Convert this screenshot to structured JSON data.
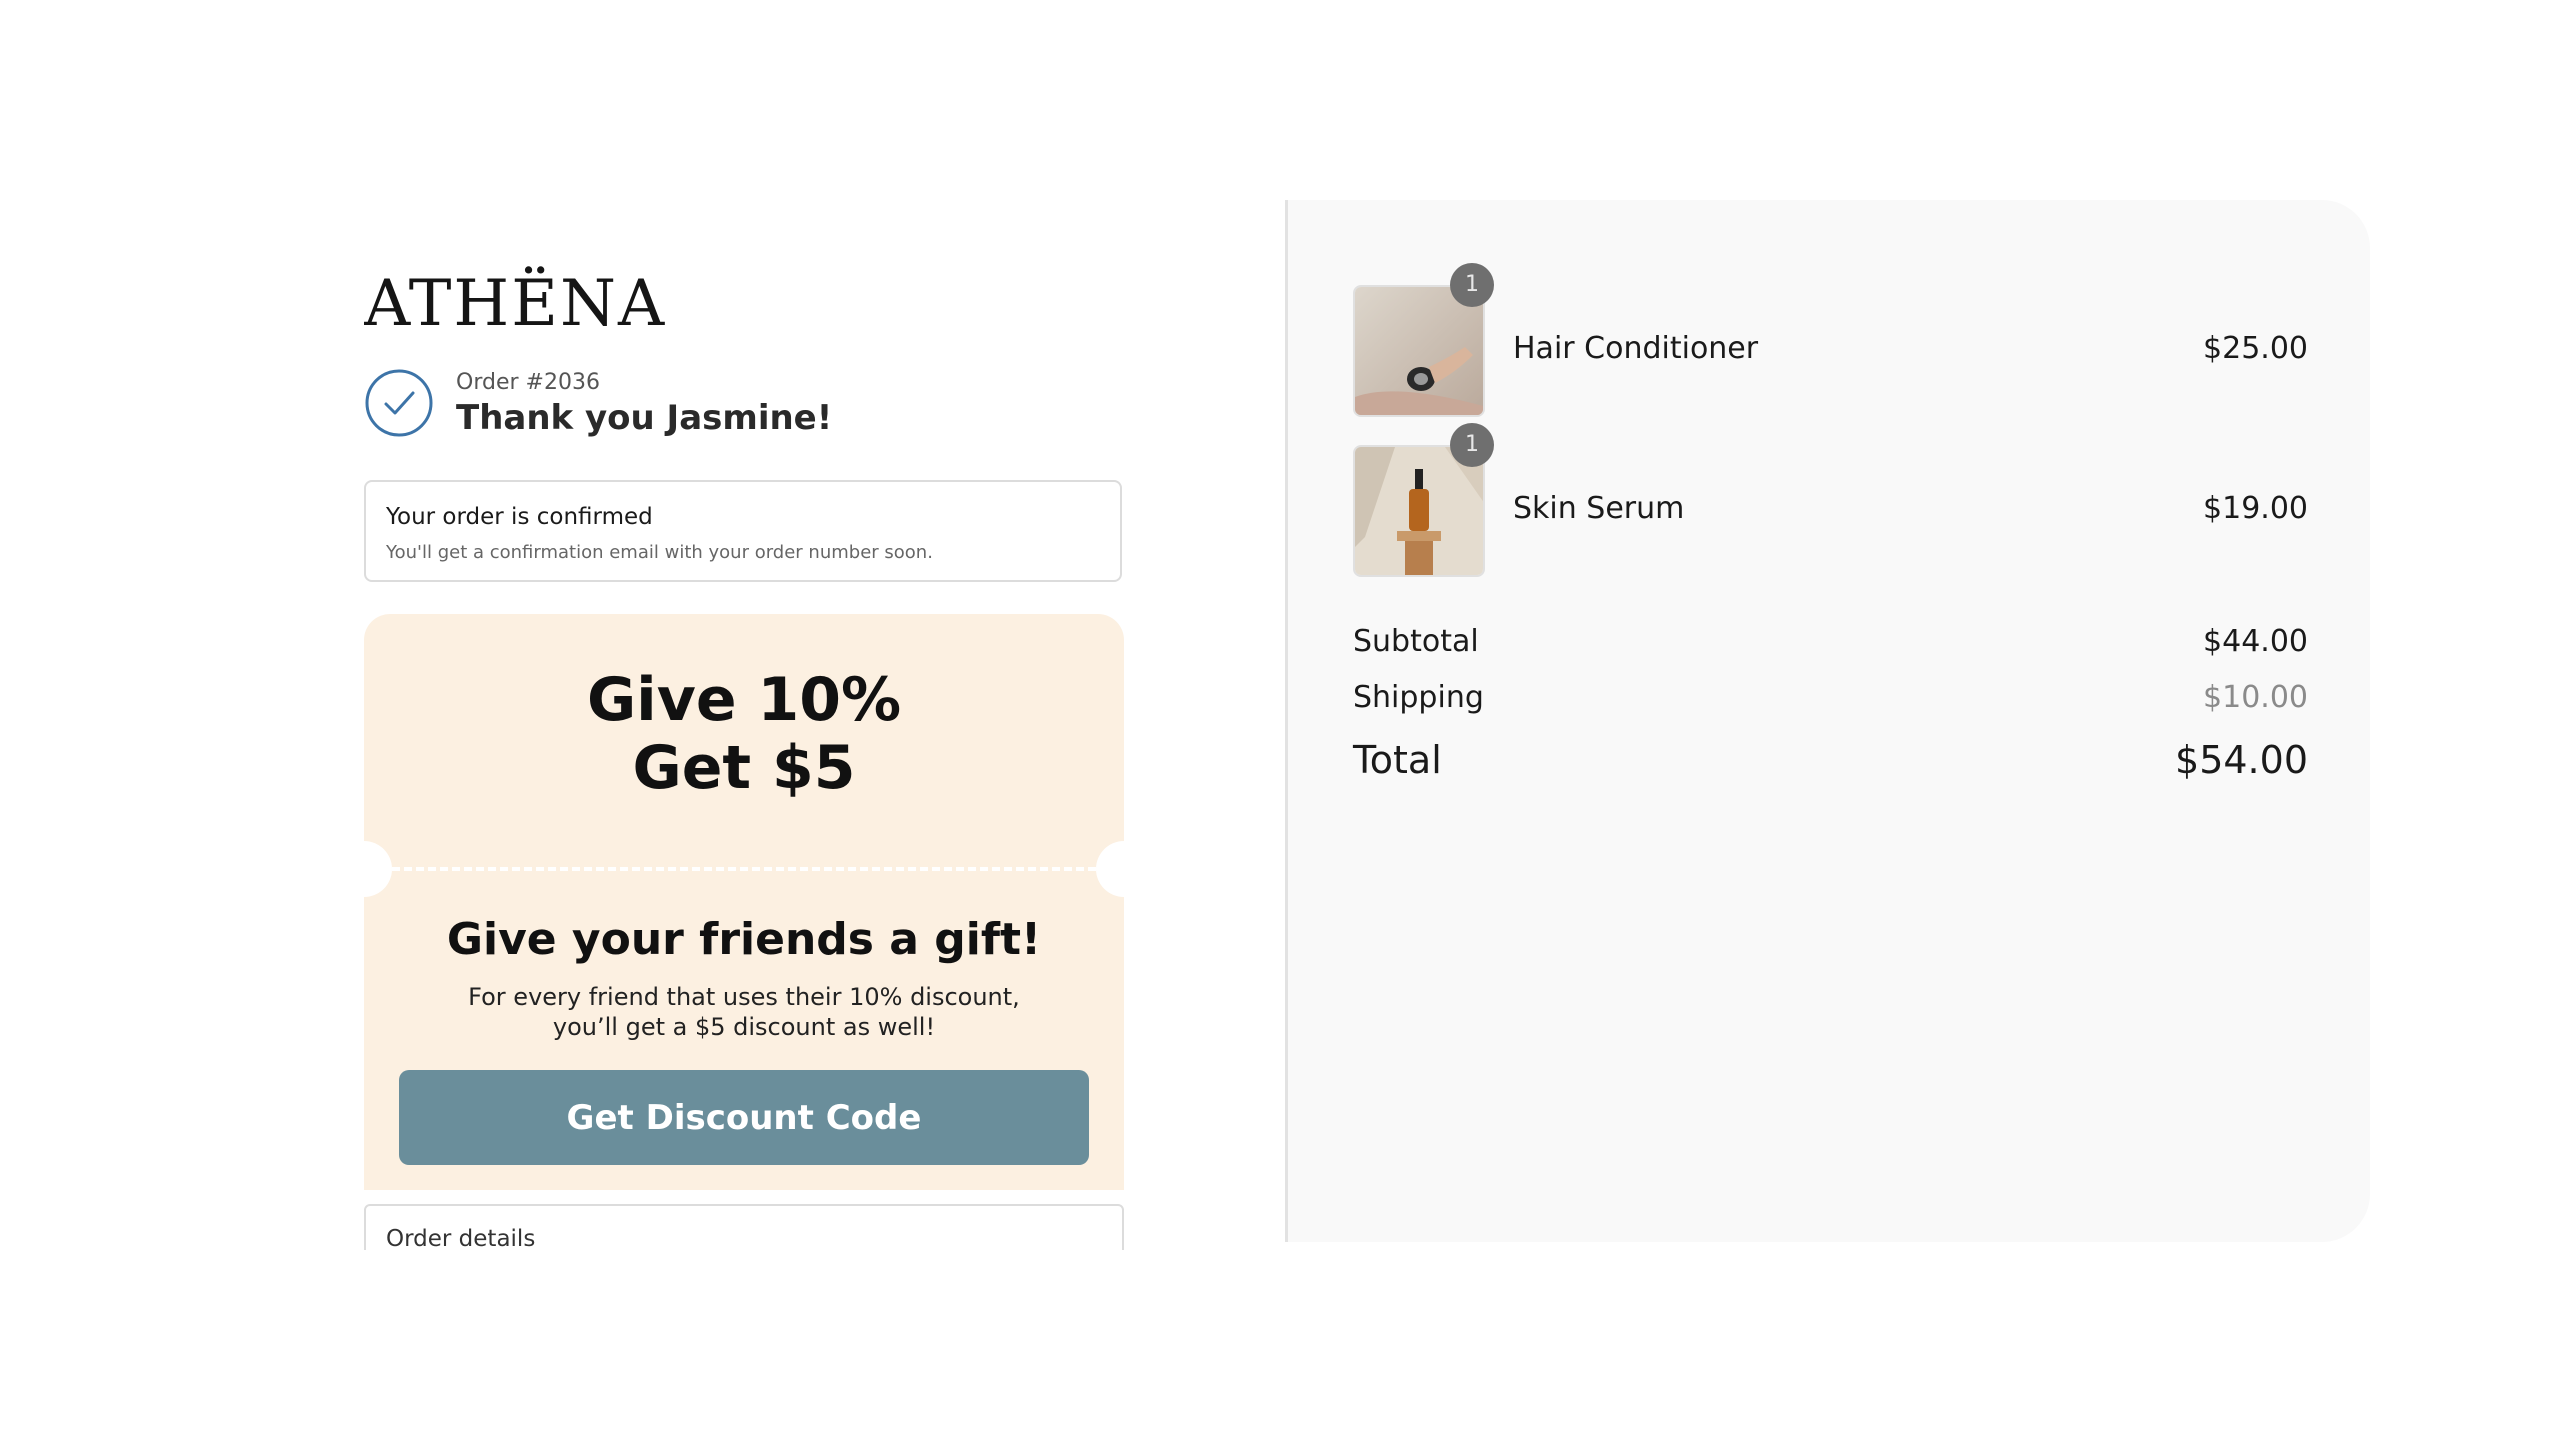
{
  "brand": {
    "logo_text": "ATHËNA"
  },
  "order": {
    "number": "Order #2036",
    "thank_you": "Thank you Jasmine!"
  },
  "confirmation": {
    "title": "Your order is confirmed",
    "text": "You'll get a confirmation email with your order number soon."
  },
  "promo": {
    "headline_line1": "Give 10%",
    "headline_line2": "Get $5",
    "gift_title": "Give your friends a gift!",
    "gift_text_line1": "For every friend that uses their 10% discount,",
    "gift_text_line2": "you’ll get a $5 discount as well!",
    "button_label": "Get Discount Code",
    "button_color": "#6a8e9b",
    "background_color": "#fcf0e1"
  },
  "order_details": {
    "label": "Order details"
  },
  "summary": {
    "items": [
      {
        "name": "Hair Conditioner",
        "price": "$25.00",
        "quantity": "1",
        "image_icon": "conditioner-jar-image"
      },
      {
        "name": "Skin Serum",
        "price": "$19.00",
        "quantity": "1",
        "image_icon": "serum-bottle-image"
      }
    ],
    "subtotal_label": "Subtotal",
    "subtotal_value": "$44.00",
    "shipping_label": "Shipping",
    "shipping_value": "$10.00",
    "total_label": "Total",
    "total_value": "$54.00"
  },
  "icons": {
    "check": "check-circle-icon"
  },
  "colors": {
    "check_accent": "#3d74a8",
    "summary_background": "#f9f9f9"
  }
}
